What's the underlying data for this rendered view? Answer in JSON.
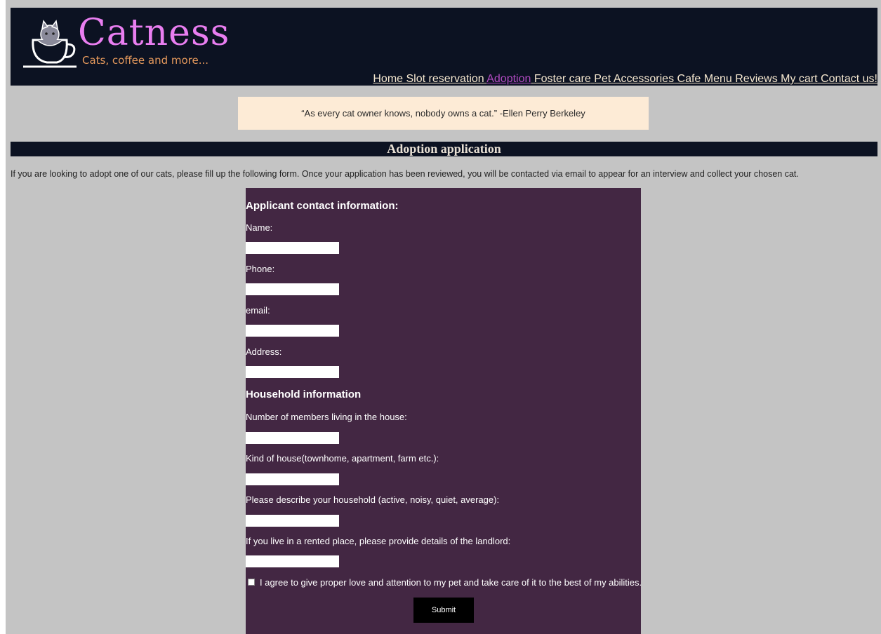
{
  "logo": {
    "title": "Catness",
    "tagline": "Cats, coffee and more..."
  },
  "nav": {
    "items": [
      {
        "label": "Home"
      },
      {
        "label": "Slot reservation"
      },
      {
        "label": "Adoption"
      },
      {
        "label": "Foster care"
      },
      {
        "label": "Pet Accessories"
      },
      {
        "label": "Cafe Menu"
      },
      {
        "label": "Reviews"
      },
      {
        "label": "My cart"
      },
      {
        "label": "Contact us!"
      }
    ],
    "active_index": 2,
    "active_color": "#b04ac0",
    "link_color": "#f5e7cf"
  },
  "quote": "“As every cat owner knows, nobody owns a cat.” -Ellen Perry Berkeley",
  "banner": "Adoption application",
  "intro": "If you are looking to adopt one of our cats, please fill up the following form. Once your application has been reviewed, you will be contacted via email to appear for an interview and collect your chosen cat.",
  "form": {
    "section_contact": "Applicant contact information:",
    "name_label": "Name:",
    "phone_label": "Phone:",
    "email_label": "email:",
    "address_label": "Address:",
    "section_household": "Household information",
    "members_label": "Number of members living in the house:",
    "house_kind_label": "Kind of house(townhome, apartment, farm etc.):",
    "describe_label": "Please describe your household (active, noisy, quiet, average):",
    "landlord_label": "If you live in a rented place, please provide details of the landlord:",
    "agree_label": "I agree to give proper love and attention to my pet and take care of it to the best of my abilities.",
    "submit_label": "Submit"
  },
  "colors": {
    "page_bg": "#c4c4c4",
    "header_bg": "#0c1222",
    "form_bg": "#432743",
    "quote_bg": "#fdebd6",
    "logo_pink": "#e97ef0",
    "logo_orange": "#e4985c"
  }
}
